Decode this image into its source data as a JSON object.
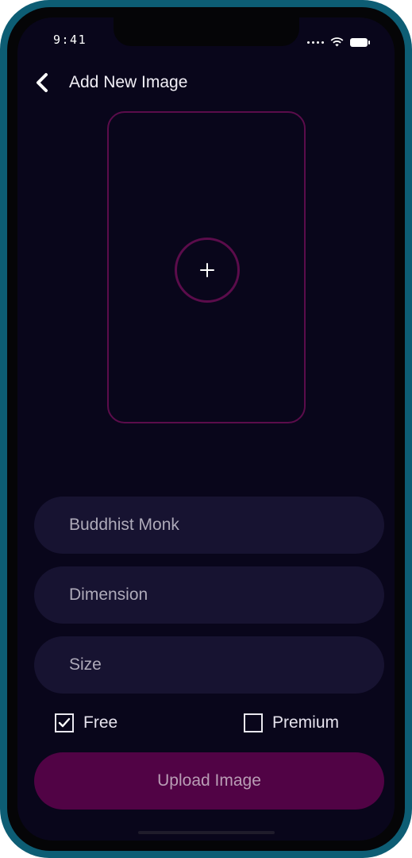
{
  "status_bar": {
    "time": "9:41",
    "icons": [
      "signal-icon",
      "wifi-icon",
      "battery-icon"
    ]
  },
  "header": {
    "back_icon": "chevron-left-icon",
    "title": "Add New Image"
  },
  "image_picker": {
    "icon": "plus-icon"
  },
  "form": {
    "name_placeholder": "Buddhist Monk",
    "dimension_placeholder": "Dimension",
    "size_placeholder": "Size"
  },
  "options": {
    "free": {
      "label": "Free",
      "checked": true
    },
    "premium": {
      "label": "Premium",
      "checked": false
    }
  },
  "upload_button": {
    "label": "Upload Image"
  },
  "colors": {
    "frame": "#0d5d74",
    "background": "#09061b",
    "field": "#171331",
    "accent": "#510345",
    "outline": "#5b0c4b"
  }
}
